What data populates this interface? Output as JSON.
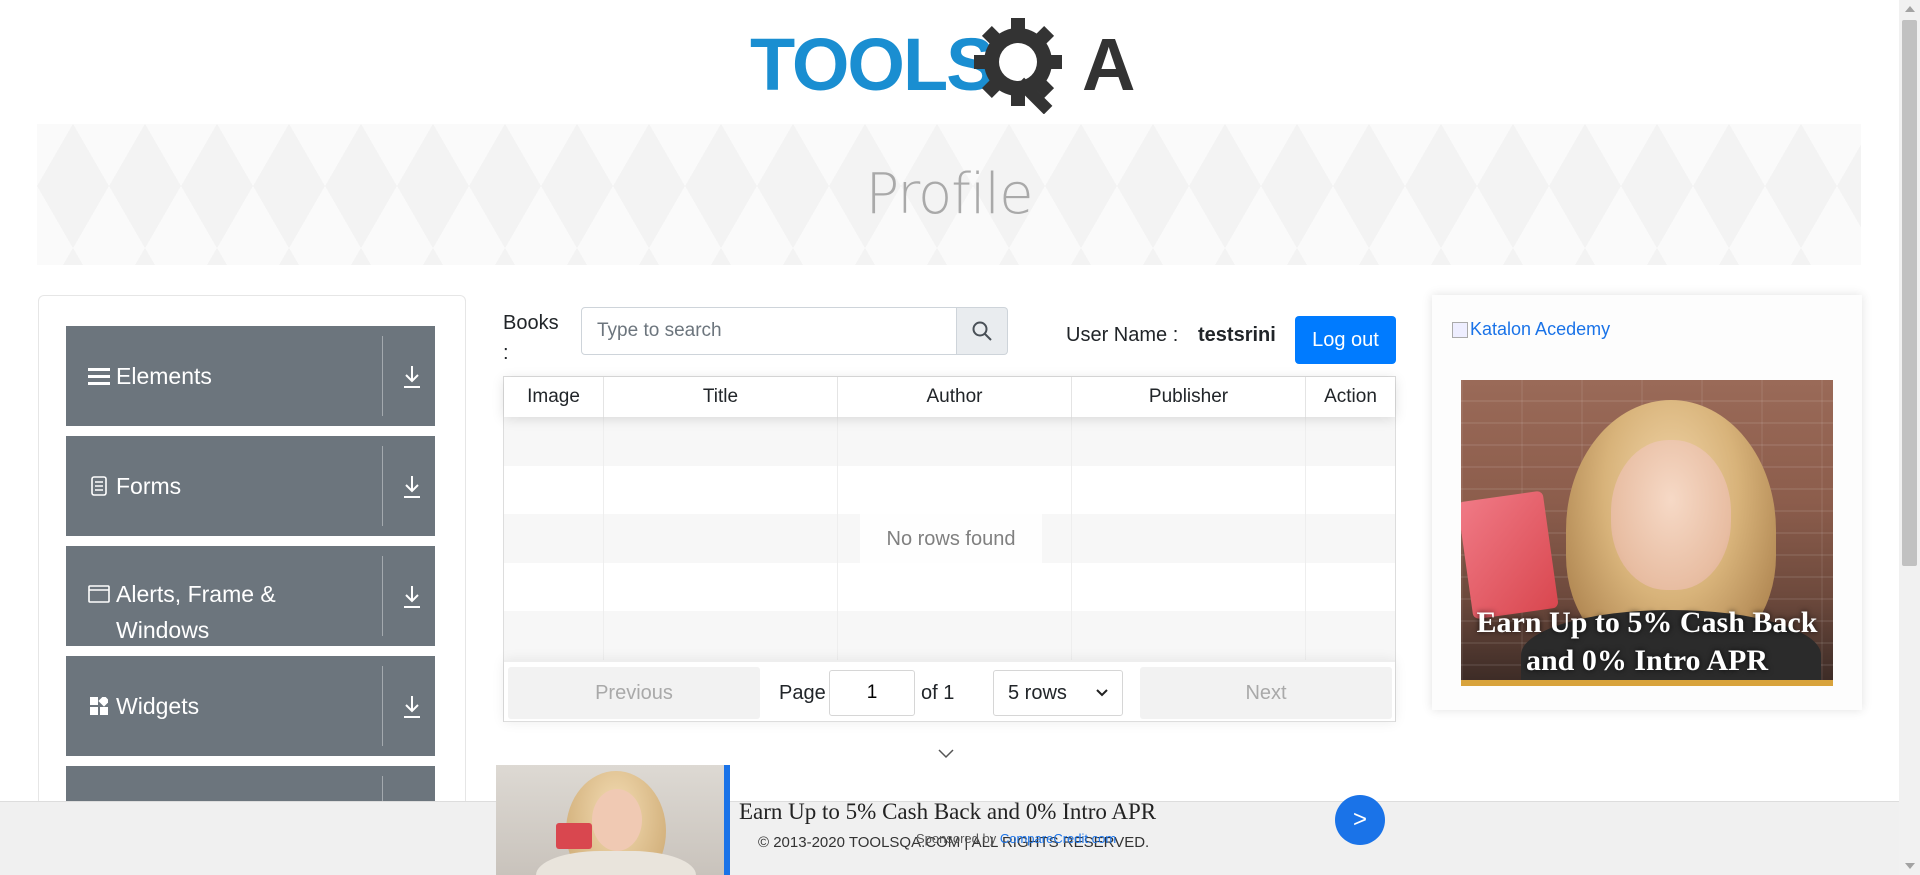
{
  "logo": {
    "text_left": "TOOLS",
    "text_right": "A",
    "colors": {
      "blue": "#1a8ed1",
      "dark": "#333333"
    }
  },
  "banner": {
    "title": "Profile"
  },
  "sidebar": {
    "groups": [
      {
        "label": "Elements",
        "icon": "hamburger-icon"
      },
      {
        "label": "Forms",
        "icon": "document-icon"
      },
      {
        "label": "Alerts, Frame & Windows",
        "icon": "window-icon"
      },
      {
        "label": "Widgets",
        "icon": "widgets-icon"
      },
      {
        "label": "",
        "icon": ""
      }
    ]
  },
  "books": {
    "label": "Books :",
    "search_placeholder": "Type to search",
    "user_label": "User Name :",
    "user_value": "testsrini",
    "logout_label": "Log out"
  },
  "table": {
    "columns": [
      "Image",
      "Title",
      "Author",
      "Publisher",
      "Action"
    ],
    "empty_text": "No rows found",
    "pager": {
      "previous": "Previous",
      "page_label": "Page",
      "page_value": "1",
      "of_text": "of 1",
      "rows_select": "5 rows",
      "next": "Next"
    }
  },
  "right_ad": {
    "link_text": "Katalon Acedemy",
    "headline": "Earn Up to 5% Cash Back and 0% Intro APR"
  },
  "bottom_ad": {
    "headline": "Earn Up to 5% Cash Back and 0% Intro APR",
    "sponsor_prefix": "Sponsored by",
    "sponsor_name": "CompareCredit.com",
    "go_label": ">"
  },
  "footer": {
    "copyright": "© 2013-2020 TOOLSQA.COM | ALL RIGHTS RESERVED."
  },
  "accent_color": "#007bff"
}
